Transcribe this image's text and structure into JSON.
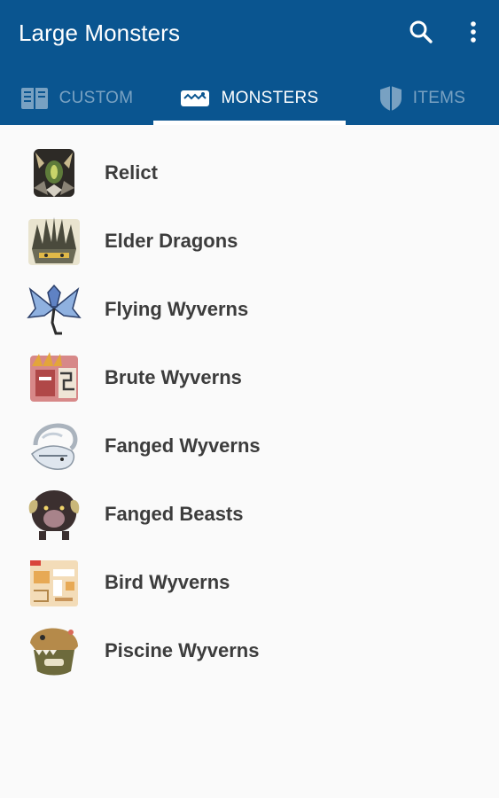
{
  "app_bar": {
    "title": "Large Monsters",
    "background": "#0a5590",
    "actions": [
      {
        "icon": "search-icon"
      },
      {
        "icon": "more-vert-icon"
      }
    ]
  },
  "tabs": [
    {
      "label": "CUSTOM",
      "icon": "book-icon",
      "active": false
    },
    {
      "label": "MONSTERS",
      "icon": "monster-jaw-icon",
      "active": true
    },
    {
      "label": "ITEMS",
      "icon": "shield-icon",
      "active": false
    }
  ],
  "categories": [
    {
      "label": "Relict",
      "icon": "relict-icon"
    },
    {
      "label": "Elder Dragons",
      "icon": "elder-dragon-icon"
    },
    {
      "label": "Flying Wyverns",
      "icon": "flying-wyvern-icon"
    },
    {
      "label": "Brute Wyverns",
      "icon": "brute-wyvern-icon"
    },
    {
      "label": "Fanged Wyverns",
      "icon": "fanged-wyvern-icon"
    },
    {
      "label": "Fanged Beasts",
      "icon": "fanged-beast-icon"
    },
    {
      "label": "Bird Wyverns",
      "icon": "bird-wyvern-icon"
    },
    {
      "label": "Piscine Wyverns",
      "icon": "piscine-wyvern-icon"
    }
  ]
}
